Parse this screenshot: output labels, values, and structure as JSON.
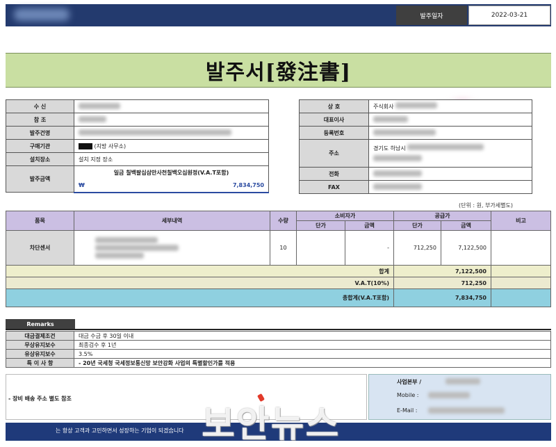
{
  "header": {
    "order_date_label": "발주일자",
    "order_date": "2022-03-21"
  },
  "title": "발주서[發注書]",
  "left_info": [
    {
      "label": "수    신",
      "value": ""
    },
    {
      "label": "참    조",
      "value": ""
    },
    {
      "label": "발주건명",
      "value": ""
    },
    {
      "label": "구매기관",
      "value": "(지방 사무소)"
    },
    {
      "label": "설치장소",
      "value": "설치 지정 장소"
    }
  ],
  "amount": {
    "label": "발주금액",
    "korean": "일금  칠백팔십삼만사천칠백오십원정(V.A.T포함)",
    "currency": "₩",
    "value": "7,834,750"
  },
  "right_info": [
    {
      "label": "상    호",
      "value": "주식회사"
    },
    {
      "label": "대표이사",
      "value": ""
    },
    {
      "label": "등록번호",
      "value": ""
    },
    {
      "label": "주소",
      "value": "경기도 하남시"
    },
    {
      "label": "전화",
      "value": ""
    },
    {
      "label": "FAX",
      "value": ""
    }
  ],
  "unit_note": "(단위 : 원, 부가세별도)",
  "items_table": {
    "headers": {
      "item": "품목",
      "detail": "세부내역",
      "qty": "수량",
      "consumer_price": "소비자가",
      "supply_price": "공급가",
      "note": "비고",
      "unit_price": "단가",
      "amount": "금액"
    },
    "rows": [
      {
        "item": "차단센서",
        "qty": "10",
        "consumer_unit": "",
        "consumer_amount": "-",
        "supply_unit": "712,250",
        "supply_amount": "7,122,500",
        "note": ""
      }
    ],
    "totals": [
      {
        "label": "합계",
        "value": "7,122,500"
      },
      {
        "label": "V.A.T(10%)",
        "value": "712,250"
      },
      {
        "label": "총합계(V.A.T포함)",
        "value": "7,834,750"
      }
    ]
  },
  "remarks": {
    "tab": "Remarks",
    "rows": [
      {
        "label": "대금결제조건",
        "value": "대금 수금 후 30일 이내"
      },
      {
        "label": "무상유지보수",
        "value": "최종검수 후 1년"
      },
      {
        "label": "유상유지보수",
        "value": "3.5%"
      },
      {
        "label": "특 이 사 항",
        "value": "- 20년 국세청 국세정보통신망 보안강화 사업의 특별할인가를 적용"
      }
    ]
  },
  "bottom_note": "- 장비 배송 주소 별도 참조",
  "contact": {
    "dept": "사업본부 /",
    "mobile": "Mobile :",
    "email": "E-Mail :"
  },
  "footer": "는 항상 고객과 고민하면서 성장하는 기업이 되겠습니다",
  "watermark": "보안뉴스"
}
